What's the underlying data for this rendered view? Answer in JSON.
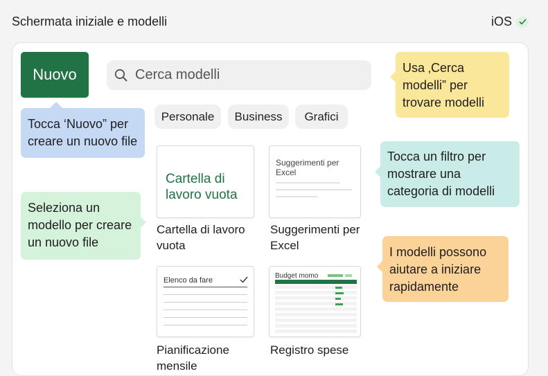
{
  "header": {
    "title": "Schermata iniziale e modelli",
    "platform": "iOS"
  },
  "toolbar": {
    "new_label": "Nuovo",
    "search_placeholder": "Cerca modelli"
  },
  "filters": [
    "Personale",
    "Business",
    "Grafici"
  ],
  "callouts": {
    "new": "Tocca ‘Nuovo” per creare un nuovo file",
    "search": "Usa ‚Cerca modelli” per trovare modelli",
    "filter": "Tocca un filtro per mostrare una categoria di modelli",
    "template": "Seleziona un modello per creare un nuovo file",
    "help": "I modelli possono aiutare a iniziare rapidamente"
  },
  "templates": [
    {
      "label": "Cartella di lavoro vuota",
      "thumb_text": "Cartella di lavoro vuota"
    },
    {
      "label": "Suggerimenti per Excel",
      "thumb_text": "Suggerimenti per Excel"
    },
    {
      "label": "Pianificazione mensile",
      "thumb_text": "Elenco da fare"
    },
    {
      "label": "Registro spese",
      "thumb_text": "Budget momo"
    }
  ],
  "colors": {
    "brand_green": "#217346",
    "callout_blue": "#c5d9f5",
    "callout_yellow": "#fbe79a",
    "callout_teal": "#c9ece8",
    "callout_green": "#d5f2db",
    "callout_orange": "#fbd298"
  },
  "icons": {
    "search": "search-icon",
    "check": "check-icon"
  }
}
